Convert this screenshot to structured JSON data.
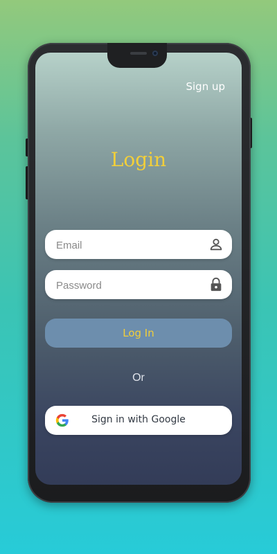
{
  "header": {
    "signup_label": "Sign up"
  },
  "title": "Login",
  "form": {
    "email_placeholder": "Email",
    "password_placeholder": "Password",
    "login_label": "Log In",
    "or_label": "Or",
    "google_label": "Sign in with Google"
  },
  "colors": {
    "accent": "#f2cf3a",
    "button": "#6d8ead",
    "background_top": "#93c97c",
    "background_bottom": "#27cbd8"
  },
  "icons": {
    "email": "user-icon",
    "password": "lock-icon",
    "google": "google-logo-icon"
  }
}
